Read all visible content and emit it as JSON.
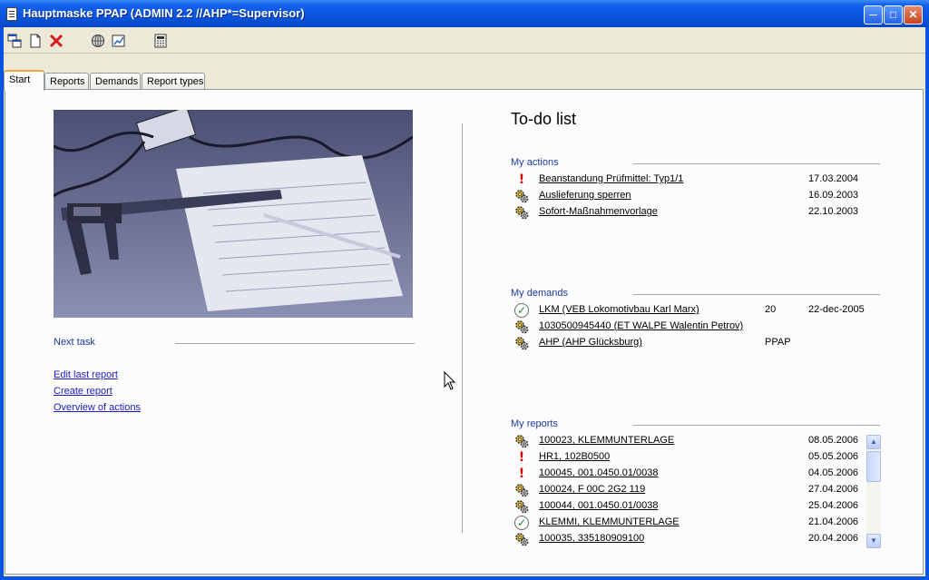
{
  "window": {
    "title": "Hauptmaske PPAP (ADMIN 2.2 //AHP*=Supervisor)"
  },
  "toolbar": {
    "icons": [
      "windows-icon",
      "new-document-icon",
      "delete-icon",
      "globe-icon",
      "chart-icon",
      "calculator-icon"
    ]
  },
  "tabs": [
    {
      "label": "Start",
      "active": true
    },
    {
      "label": "Reports"
    },
    {
      "label": "Demands"
    },
    {
      "label": "Report types"
    }
  ],
  "left": {
    "next_task_label": "Next task",
    "links": [
      "Edit last report",
      "Create report",
      "Overview of actions"
    ]
  },
  "todo": {
    "title": "To-do list",
    "my_actions": {
      "label": "My actions",
      "items": [
        {
          "icon": "exclamation-icon",
          "text": "Beanstandung Prüfmittel: Typ1/1",
          "date": "17.03.2004"
        },
        {
          "icon": "gears-icon",
          "text": "Auslieferung sperren",
          "date": "16.09.2003"
        },
        {
          "icon": "gears-icon",
          "text": "Sofort-Maßnahmenvorlage",
          "date": "22.10.2003"
        }
      ]
    },
    "my_demands": {
      "label": "My demands",
      "items": [
        {
          "icon": "check-icon",
          "text": "LKM (VEB Lokomotivbau Karl Marx)",
          "col": "20",
          "date": "22-dec-2005"
        },
        {
          "icon": "gears-icon",
          "text": "1030500945440 (ET WALPE Walentin Petrov)",
          "col": "",
          "date": ""
        },
        {
          "icon": "gears-icon",
          "text": "AHP (AHP Glücksburg)",
          "col": "PPAP",
          "date": ""
        }
      ]
    },
    "my_reports": {
      "label": "My reports",
      "items": [
        {
          "icon": "gears-icon",
          "text": "100023, KLEMMUNTERLAGE",
          "date": "08.05.2006"
        },
        {
          "icon": "exclamation-icon",
          "text": "HR1, 102B0500",
          "date": "05.05.2006"
        },
        {
          "icon": "exclamation-icon",
          "text": "100045, 001.0450.01/0038",
          "date": "04.05.2006"
        },
        {
          "icon": "gears-icon",
          "text": "100024, F 00C 2G2 119",
          "date": "27.04.2006"
        },
        {
          "icon": "gears-icon",
          "text": "100044, 001.0450.01/0038",
          "date": "25.04.2006"
        },
        {
          "icon": "check-icon",
          "text": "KLEMMI, KLEMMUNTERLAGE",
          "date": "21.04.2006"
        },
        {
          "icon": "gears-icon",
          "text": "100035, 335180909100",
          "date": "20.04.2006"
        }
      ]
    }
  }
}
